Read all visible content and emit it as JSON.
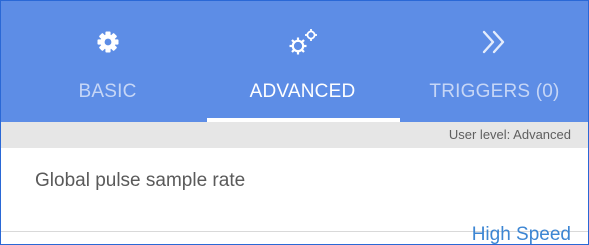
{
  "tabs": [
    {
      "label": "BASIC",
      "icon": "gear-icon"
    },
    {
      "label": "ADVANCED",
      "icon": "gears-icon"
    },
    {
      "label": "TRIGGERS (0)",
      "icon": "double-chevron-right-icon"
    }
  ],
  "selected_tab": "ADVANCED",
  "user_level": "User level: Advanced",
  "settings": [
    {
      "name": "Global pulse sample rate",
      "value": "High Speed"
    }
  ],
  "colors": {
    "tabbar": "#5d8de6",
    "active_tab_text": "#ffffff",
    "inactive_tab_text": "#c6d6f6",
    "value_text": "#3d86d3"
  }
}
